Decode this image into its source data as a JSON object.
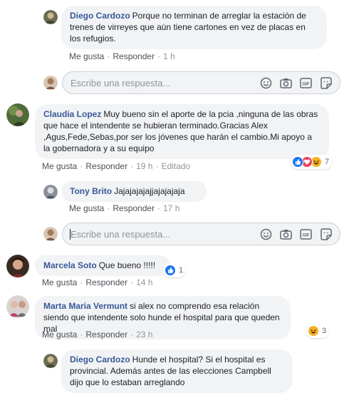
{
  "colors": {
    "name": "#385898",
    "bubble": "#f2f3f5",
    "meta": "#90949c",
    "like": "#1877f2",
    "love": "#f33e58",
    "haha": "#f7b125"
  },
  "comments": [
    {
      "author": "Diego Cardozo",
      "text": "Porque no terminan de arreglar la estación de trenes de virreyes que aún tiene cartones en vez de placas en los refugios.",
      "like": "Me gusta",
      "reply": "Responder",
      "time": "1 h"
    },
    {
      "author": "Claudia Lopez",
      "text": "Muy bueno sin el aporte de la pcia ,ninguna de las obras que hace el intendente se hubieran terminado.Gracias Alex ,Agus,Fede,Sebas,por ser los jóvenes que harán el cambio.Mi apoyo a la gobernadora y a su equipo",
      "like": "Me gusta",
      "reply": "Responder",
      "time": "19 h",
      "edited": "Editado",
      "reaction_count": "7",
      "reactions": [
        "like-icon",
        "love-icon",
        "haha-icon"
      ]
    },
    {
      "author": "Tony Brito",
      "text": "Jajajajajajjajajajaja",
      "like": "Me gusta",
      "reply": "Responder",
      "time": "17 h"
    },
    {
      "author": "Marcela Soto",
      "text": "Que bueno !!!!!",
      "like": "Me gusta",
      "reply": "Responder",
      "time": "14 h",
      "reaction_count": "1",
      "reactions": [
        "like-icon"
      ]
    },
    {
      "author": "Marta Maria Vermunt",
      "text": "si alex no comprendo esa relación siendo que intendente solo hunde el hospital para que queden mal",
      "like": "Me gusta",
      "reply": "Responder",
      "time": "23 h",
      "reaction_count": "3",
      "reactions": [
        "haha-icon"
      ]
    },
    {
      "author": "Diego Cardozo",
      "text": "Hunde el hospital? Si el hospital es provincial. Además antes de las elecciones Campbell dijo que lo estaban arreglando"
    }
  ],
  "reply_box": {
    "placeholder": "Escribe una respuesta..."
  },
  "reply_icons": [
    "emoji-icon",
    "camera-icon",
    "gif-icon",
    "sticker-icon"
  ],
  "dot": "·"
}
